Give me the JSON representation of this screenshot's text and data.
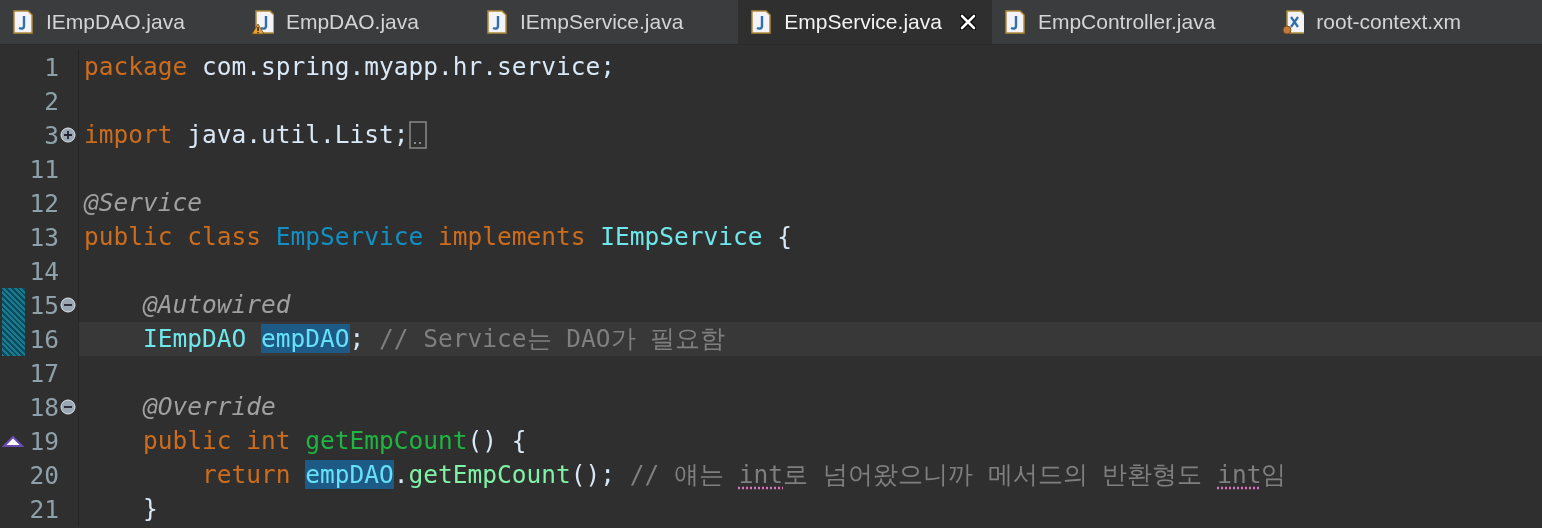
{
  "tabs": [
    {
      "label": "IEmpDAO.java",
      "kind": "java",
      "selected": false
    },
    {
      "label": "EmpDAO.java",
      "kind": "java-warning",
      "selected": false
    },
    {
      "label": "IEmpService.java",
      "kind": "java",
      "selected": false
    },
    {
      "label": "EmpService.java",
      "kind": "java",
      "selected": true
    },
    {
      "label": "EmpController.java",
      "kind": "java",
      "selected": false
    },
    {
      "label": "root-context.xm",
      "kind": "xml",
      "selected": false
    }
  ],
  "editor": {
    "lines": [
      {
        "number": "1",
        "tokens": [
          {
            "kind": "keyword",
            "text": "package "
          },
          {
            "kind": "plain",
            "text": "com.spring.myapp.hr.service;"
          }
        ]
      },
      {
        "number": "2"
      },
      {
        "number": "3",
        "expanded": false,
        "tokens": [
          {
            "kind": "keyword",
            "text": "import "
          },
          {
            "kind": "plain",
            "text": "java.util.List;"
          }
        ]
      },
      {
        "number": "11"
      },
      {
        "number": "12",
        "tokens": [
          {
            "kind": "annotation",
            "text": "@Service"
          }
        ]
      },
      {
        "number": "13",
        "tokens": [
          {
            "kind": "keyword",
            "text": "public class "
          },
          {
            "kind": "class",
            "text": "EmpService "
          },
          {
            "kind": "keyword",
            "text": "implements "
          },
          {
            "kind": "interface",
            "text": "IEmpService "
          },
          {
            "kind": "plain",
            "text": "{"
          }
        ]
      },
      {
        "number": "14"
      },
      {
        "number": "15",
        "expanded": true,
        "changed": true,
        "tokens": [
          {
            "kind": "annotation",
            "text": "    @Autowired"
          }
        ]
      },
      {
        "number": "16",
        "changed": true,
        "current": true,
        "tokens": [
          {
            "kind": "interface",
            "text": "    IEmpDAO "
          },
          {
            "kind": "field-occurrence",
            "text": "empDAO"
          },
          {
            "kind": "plain",
            "text": "; "
          },
          {
            "kind": "comment",
            "text": "// Service는 DAO가 필요함"
          }
        ]
      },
      {
        "number": "17"
      },
      {
        "number": "18",
        "expanded": true,
        "tokens": [
          {
            "kind": "annotation",
            "text": "    @Override"
          }
        ]
      },
      {
        "number": "19",
        "overridden": true,
        "tokens": [
          {
            "kind": "keyword",
            "text": "    public int "
          },
          {
            "kind": "method",
            "text": "getEmpCount"
          },
          {
            "kind": "plain",
            "text": "() {"
          }
        ]
      },
      {
        "number": "20",
        "tokens": [
          {
            "kind": "keyword",
            "text": "        return "
          },
          {
            "kind": "field-occurrence",
            "text": "empDAO"
          },
          {
            "kind": "plain",
            "text": "."
          },
          {
            "kind": "call",
            "text": "getEmpCount"
          },
          {
            "kind": "plain",
            "text": "(); "
          },
          {
            "kind": "comment",
            "text": "// 얘는 "
          },
          {
            "kind": "comment-misspelled",
            "text": "int"
          },
          {
            "kind": "comment",
            "text": "로 넘어왔으니까 메서드의 반환형도 "
          },
          {
            "kind": "comment-misspelled",
            "text": "int"
          },
          {
            "kind": "comment",
            "text": "임"
          }
        ]
      },
      {
        "number": "21",
        "tokens": [
          {
            "kind": "plain",
            "text": "    }"
          }
        ]
      }
    ]
  }
}
